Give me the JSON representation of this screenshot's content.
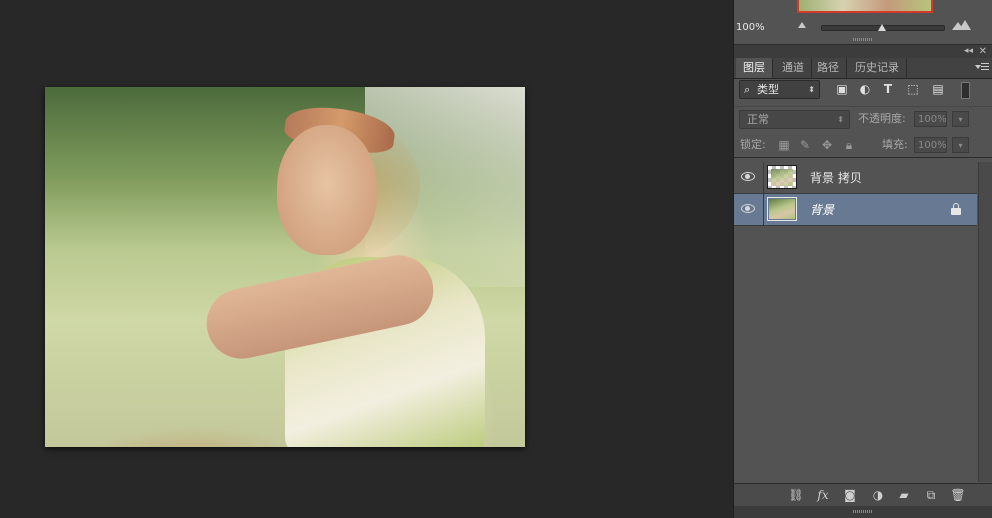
{
  "canvas": {
    "image_description_visible": false
  },
  "navigator": {
    "zoom": "100%"
  },
  "layers_panel": {
    "tabs": [
      {
        "label": "图层",
        "active": true
      },
      {
        "label": "通道",
        "active": false
      },
      {
        "label": "路径",
        "active": false
      },
      {
        "label": "历史记录",
        "active": false
      }
    ],
    "filter": {
      "icon": "magnifier-icon",
      "kind": "类型",
      "arrow": "⬍"
    },
    "filter_icons": [
      "image-filter-icon",
      "adjustment-filter-icon",
      "type-filter-icon",
      "shape-filter-icon",
      "smart-object-filter-icon"
    ],
    "blend_mode": "正常",
    "opacity_label": "不透明度:",
    "opacity_value": "100%",
    "lock_label": "锁定:",
    "fill_label": "填充:",
    "fill_value": "100%",
    "layers": [
      {
        "name": "背景 拷贝",
        "visible": true,
        "selected": false,
        "locked": false
      },
      {
        "name": "背景",
        "visible": true,
        "selected": true,
        "locked": true
      }
    ]
  },
  "colors": {
    "workspace": "#282828",
    "panel": "#535353",
    "selected_layer": "#687a93",
    "nav_box": "#d63a2a"
  }
}
